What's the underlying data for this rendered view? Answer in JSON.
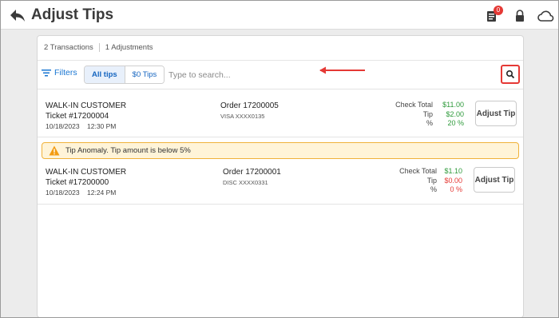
{
  "header": {
    "title": "Adjust Tips",
    "notification_count": "0",
    "icons": [
      "back-arrow-icon",
      "receipt-icon",
      "lock-icon",
      "cloud-icon"
    ]
  },
  "summary": {
    "transactions": "2 Transactions",
    "adjustments": "1 Adjustments"
  },
  "toolbar": {
    "filters_label": "Filters",
    "tabs": [
      {
        "label": "All tips",
        "active": true
      },
      {
        "label": "$0 Tips",
        "active": false
      }
    ],
    "search_placeholder": "Type to search..."
  },
  "alert": {
    "text": "Tip Anomaly. Tip amount is below 5%"
  },
  "summary_labels": {
    "check_total": "Check Total",
    "tip": "Tip",
    "percent": "%"
  },
  "transactions": [
    {
      "customer": "WALK-IN CUSTOMER",
      "ticket": "Ticket #17200004",
      "date": "10/18/2023",
      "time": "12:30 PM",
      "order": "Order 17200005",
      "card": "VISA XXXX0135",
      "check_total": "$11.00",
      "tip": "$2.00",
      "percent": "20 %",
      "button": "Adjust Tip"
    },
    {
      "customer": "WALK-IN CUSTOMER",
      "ticket": "Ticket #17200000",
      "date": "10/18/2023",
      "time": "12:24 PM",
      "order": "Order 17200001",
      "card": "DISC XXXX0331",
      "check_total": "$1.10",
      "tip": "$0.00",
      "percent": "0 %",
      "button": "Adjust Tip"
    }
  ],
  "colors": {
    "accent": "#1976d2",
    "positive": "#2e9a3b",
    "negative": "#e53935",
    "alert_bg": "#fff4d8",
    "alert_border": "#f0b23a"
  }
}
